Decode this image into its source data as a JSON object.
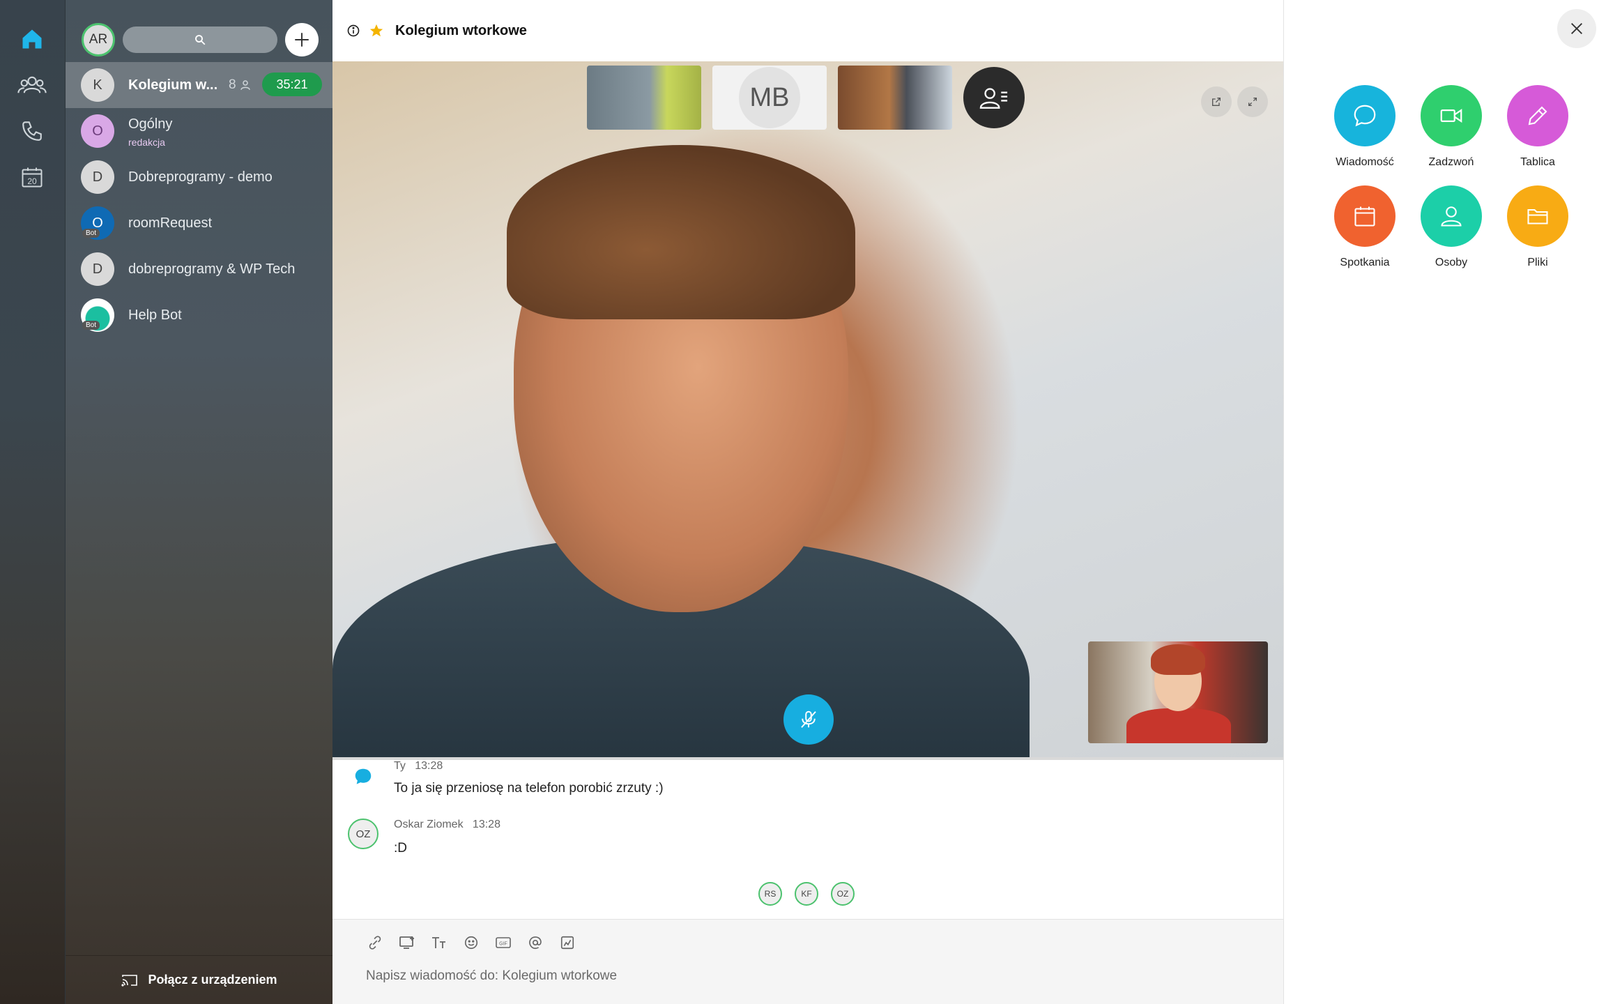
{
  "me": {
    "initials": "AR"
  },
  "rooms": [
    {
      "initial": "K",
      "name": "Kolegium w...",
      "count": "8",
      "timer": "35:21",
      "active": true
    },
    {
      "initial": "O",
      "name": "Ogólny",
      "sub": "redakcja"
    },
    {
      "initial": "D",
      "name": "Dobreprogramy - demo"
    },
    {
      "initial": "O",
      "name": "roomRequest",
      "bot": "Bot"
    },
    {
      "initial": "D",
      "name": "dobreprogramy & WP Tech"
    },
    {
      "initial": "",
      "name": "Help Bot",
      "bot": "Bot"
    }
  ],
  "connect_label": "Połącz z urządzeniem",
  "calendar_day": "20",
  "header": {
    "title": "Kolegium wtorkowe"
  },
  "video": {
    "thumb_initials": "MB"
  },
  "messages": [
    {
      "author": "Ty",
      "time": "13:28",
      "text": "To ja się przeniosę na telefon porobić zrzuty :)"
    },
    {
      "author": "Oskar Ziomek",
      "time": "13:28",
      "text": ":D",
      "initials": "OZ"
    }
  ],
  "read_receipts": [
    "RS",
    "KF",
    "OZ"
  ],
  "composer": {
    "placeholder": "Napisz wiadomość do: Kolegium wtorkowe"
  },
  "actions": [
    {
      "label": "Wiadomość",
      "color": "#17b4dc",
      "icon": "chat-icon"
    },
    {
      "label": "Zadzwoń",
      "color": "#2fcf6e",
      "icon": "video-camera-icon"
    },
    {
      "label": "Tablica",
      "color": "#d65ad8",
      "icon": "pencil-icon"
    },
    {
      "label": "Spotkania",
      "color": "#f0622f",
      "icon": "calendar-icon"
    },
    {
      "label": "Osoby",
      "color": "#1ccfa8",
      "icon": "person-icon"
    },
    {
      "label": "Pliki",
      "color": "#f8ab14",
      "icon": "folder-icon"
    }
  ],
  "colors": {
    "accent": "#17aee0",
    "timer": "#1f9b4d",
    "star": "#f4b400"
  }
}
